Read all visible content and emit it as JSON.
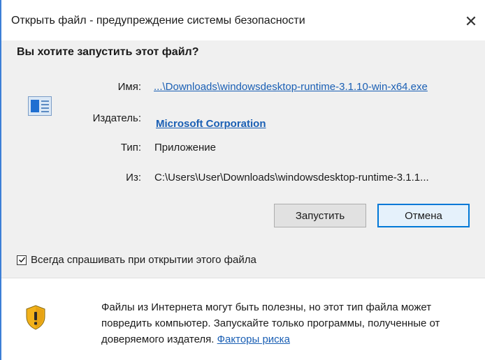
{
  "window": {
    "title": "Открыть файл - предупреждение системы безопасности",
    "close_glyph": "✕"
  },
  "dialog": {
    "heading": "Вы хотите запустить этот файл?",
    "fields": {
      "name_label": "Имя:",
      "name_value": "...\\Downloads\\windowsdesktop-runtime-3.1.10-win-x64.exe",
      "publisher_label": "Издатель:",
      "publisher_value": "Microsoft Corporation",
      "type_label": "Тип:",
      "type_value": "Приложение",
      "from_label": "Из:",
      "from_value": "C:\\Users\\User\\Downloads\\windowsdesktop-runtime-3.1.1..."
    },
    "buttons": {
      "run_label": "Запустить",
      "cancel_label": "Отмена"
    },
    "checkbox": {
      "label": "Всегда спрашивать при открытии этого файла",
      "checked": true
    }
  },
  "warning": {
    "text": "Файлы из Интернета могут быть полезны, но этот тип файла может повредить компьютер. Запускайте только программы, полученные от доверяемого издателя.",
    "link_label": "Факторы риска"
  },
  "icons": {
    "file": "application-file-icon",
    "shield": "security-shield-icon",
    "close": "close-icon",
    "checkmark": "checkmark-icon"
  },
  "colors": {
    "link": "#1a5fb4",
    "primary_border": "#0078d7",
    "panel_bg": "#f0f0f0",
    "window_border": "#3c7fd6"
  }
}
